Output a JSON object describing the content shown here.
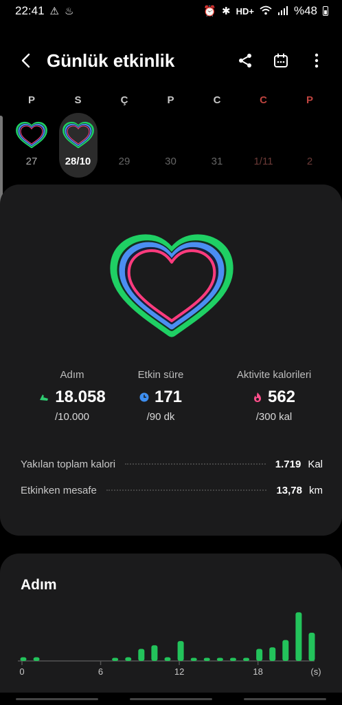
{
  "status_bar": {
    "time": "22:41",
    "network": "HD+",
    "battery": "%48",
    "left_icons": [
      "warning-icon",
      "notification-icon"
    ],
    "right_icons": [
      "alarm-icon",
      "bluetooth-icon",
      "wifi-icon",
      "signal-icon"
    ]
  },
  "header": {
    "title": "Günlük etkinlik",
    "actions": [
      "share-icon",
      "calendar-icon",
      "more-icon"
    ]
  },
  "week": [
    {
      "letter": "P",
      "date": "27",
      "has_activity": true,
      "selected": false,
      "weekend": false,
      "state": "past"
    },
    {
      "letter": "S",
      "date": "28/10",
      "has_activity": true,
      "selected": true,
      "weekend": false,
      "state": "today"
    },
    {
      "letter": "Ç",
      "date": "29",
      "has_activity": false,
      "selected": false,
      "weekend": false,
      "state": "future"
    },
    {
      "letter": "P",
      "date": "30",
      "has_activity": false,
      "selected": false,
      "weekend": false,
      "state": "future"
    },
    {
      "letter": "C",
      "date": "31",
      "has_activity": false,
      "selected": false,
      "weekend": false,
      "state": "future"
    },
    {
      "letter": "C",
      "date": "1/11",
      "has_activity": false,
      "selected": false,
      "weekend": true,
      "state": "future"
    },
    {
      "letter": "P",
      "date": "2",
      "has_activity": false,
      "selected": false,
      "weekend": true,
      "state": "future"
    }
  ],
  "metrics": {
    "steps": {
      "label": "Adım",
      "value": "18.058",
      "goal": "/10.000",
      "icon": "shoe-icon",
      "color": "#2ecc71"
    },
    "active_time": {
      "label": "Etkin süre",
      "value": "171",
      "goal": "/90 dk",
      "icon": "clock-icon",
      "color": "#3d8ef0"
    },
    "calories": {
      "label": "Aktivite kalorileri",
      "value": "562",
      "goal": "/300 kal",
      "icon": "flame-icon",
      "color": "#ff4f8b"
    }
  },
  "details": [
    {
      "label": "Yakılan toplam kalori",
      "value": "1.719",
      "unit": "Kal"
    },
    {
      "label": "Etkinken mesafe",
      "value": "13,78",
      "unit": "km"
    }
  ],
  "steps_chart": {
    "title": "Adım",
    "accent": "#23c35b",
    "x_ticks": [
      "0",
      "6",
      "12",
      "18",
      "(s)"
    ],
    "tick_hours": [
      0,
      6,
      12,
      18
    ],
    "hourly_levels": [
      0.07,
      0.07,
      0,
      0,
      0,
      0,
      0,
      0.06,
      0.07,
      0.23,
      0.3,
      0.07,
      0.38,
      0.06,
      0.06,
      0.06,
      0.06,
      0.06,
      0.23,
      0.26,
      0.4,
      0.93,
      0.54
    ]
  },
  "ring_colors": {
    "outer": "#1fd064",
    "middle": "#4b8ef2",
    "inner": "#ff3b7d"
  }
}
